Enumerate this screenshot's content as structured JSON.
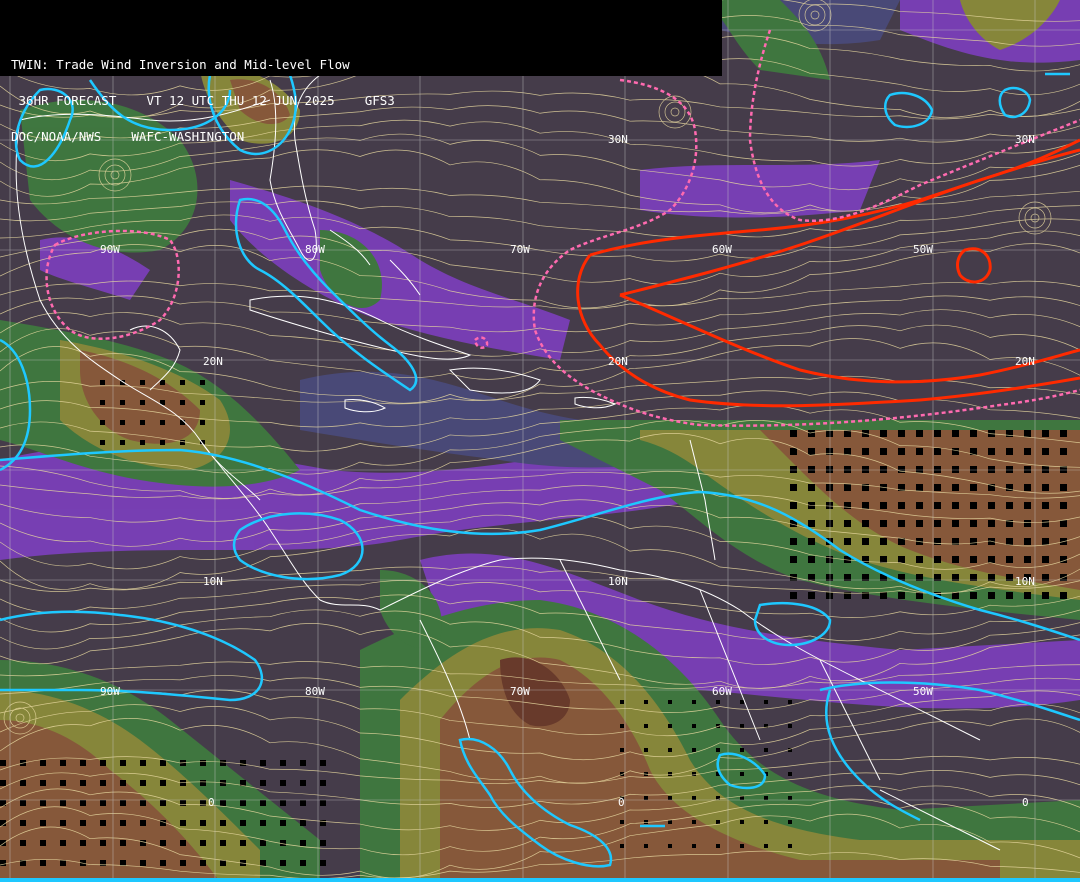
{
  "header": {
    "line1": "TWIN: Trade Wind Inversion and Mid-level Flow",
    "line2": " 36HR FORECAST    VT 12 UTC THU 12 JUN 2025    GFS3",
    "line3": "DOC/NOAA/NWS    WAFC-WASHINGTON"
  },
  "grid_labels": {
    "lat_30": "30N",
    "lat_20": "20N",
    "lat_10": "10N",
    "lat_0": "0",
    "lon_90": "90W",
    "lon_80": "80W",
    "lon_70": "70W",
    "lon_60": "60W",
    "lon_50": "50W"
  },
  "colors": {
    "background": "#453c4a",
    "purple": "#7a3fb8",
    "slate": "#4a4a7a",
    "green": "#3f7a3f",
    "olive": "#8a8a3a",
    "brown": "#8a5a3a",
    "darkbrown": "#6a3a2a",
    "streamline": "#e8d9a0",
    "cyan_contour": "#1ec8ff",
    "red_contour": "#ff2a00",
    "pink_dashed": "#ff6ab0",
    "coastline": "#ffffff",
    "gridline": "#c8c8c8"
  }
}
